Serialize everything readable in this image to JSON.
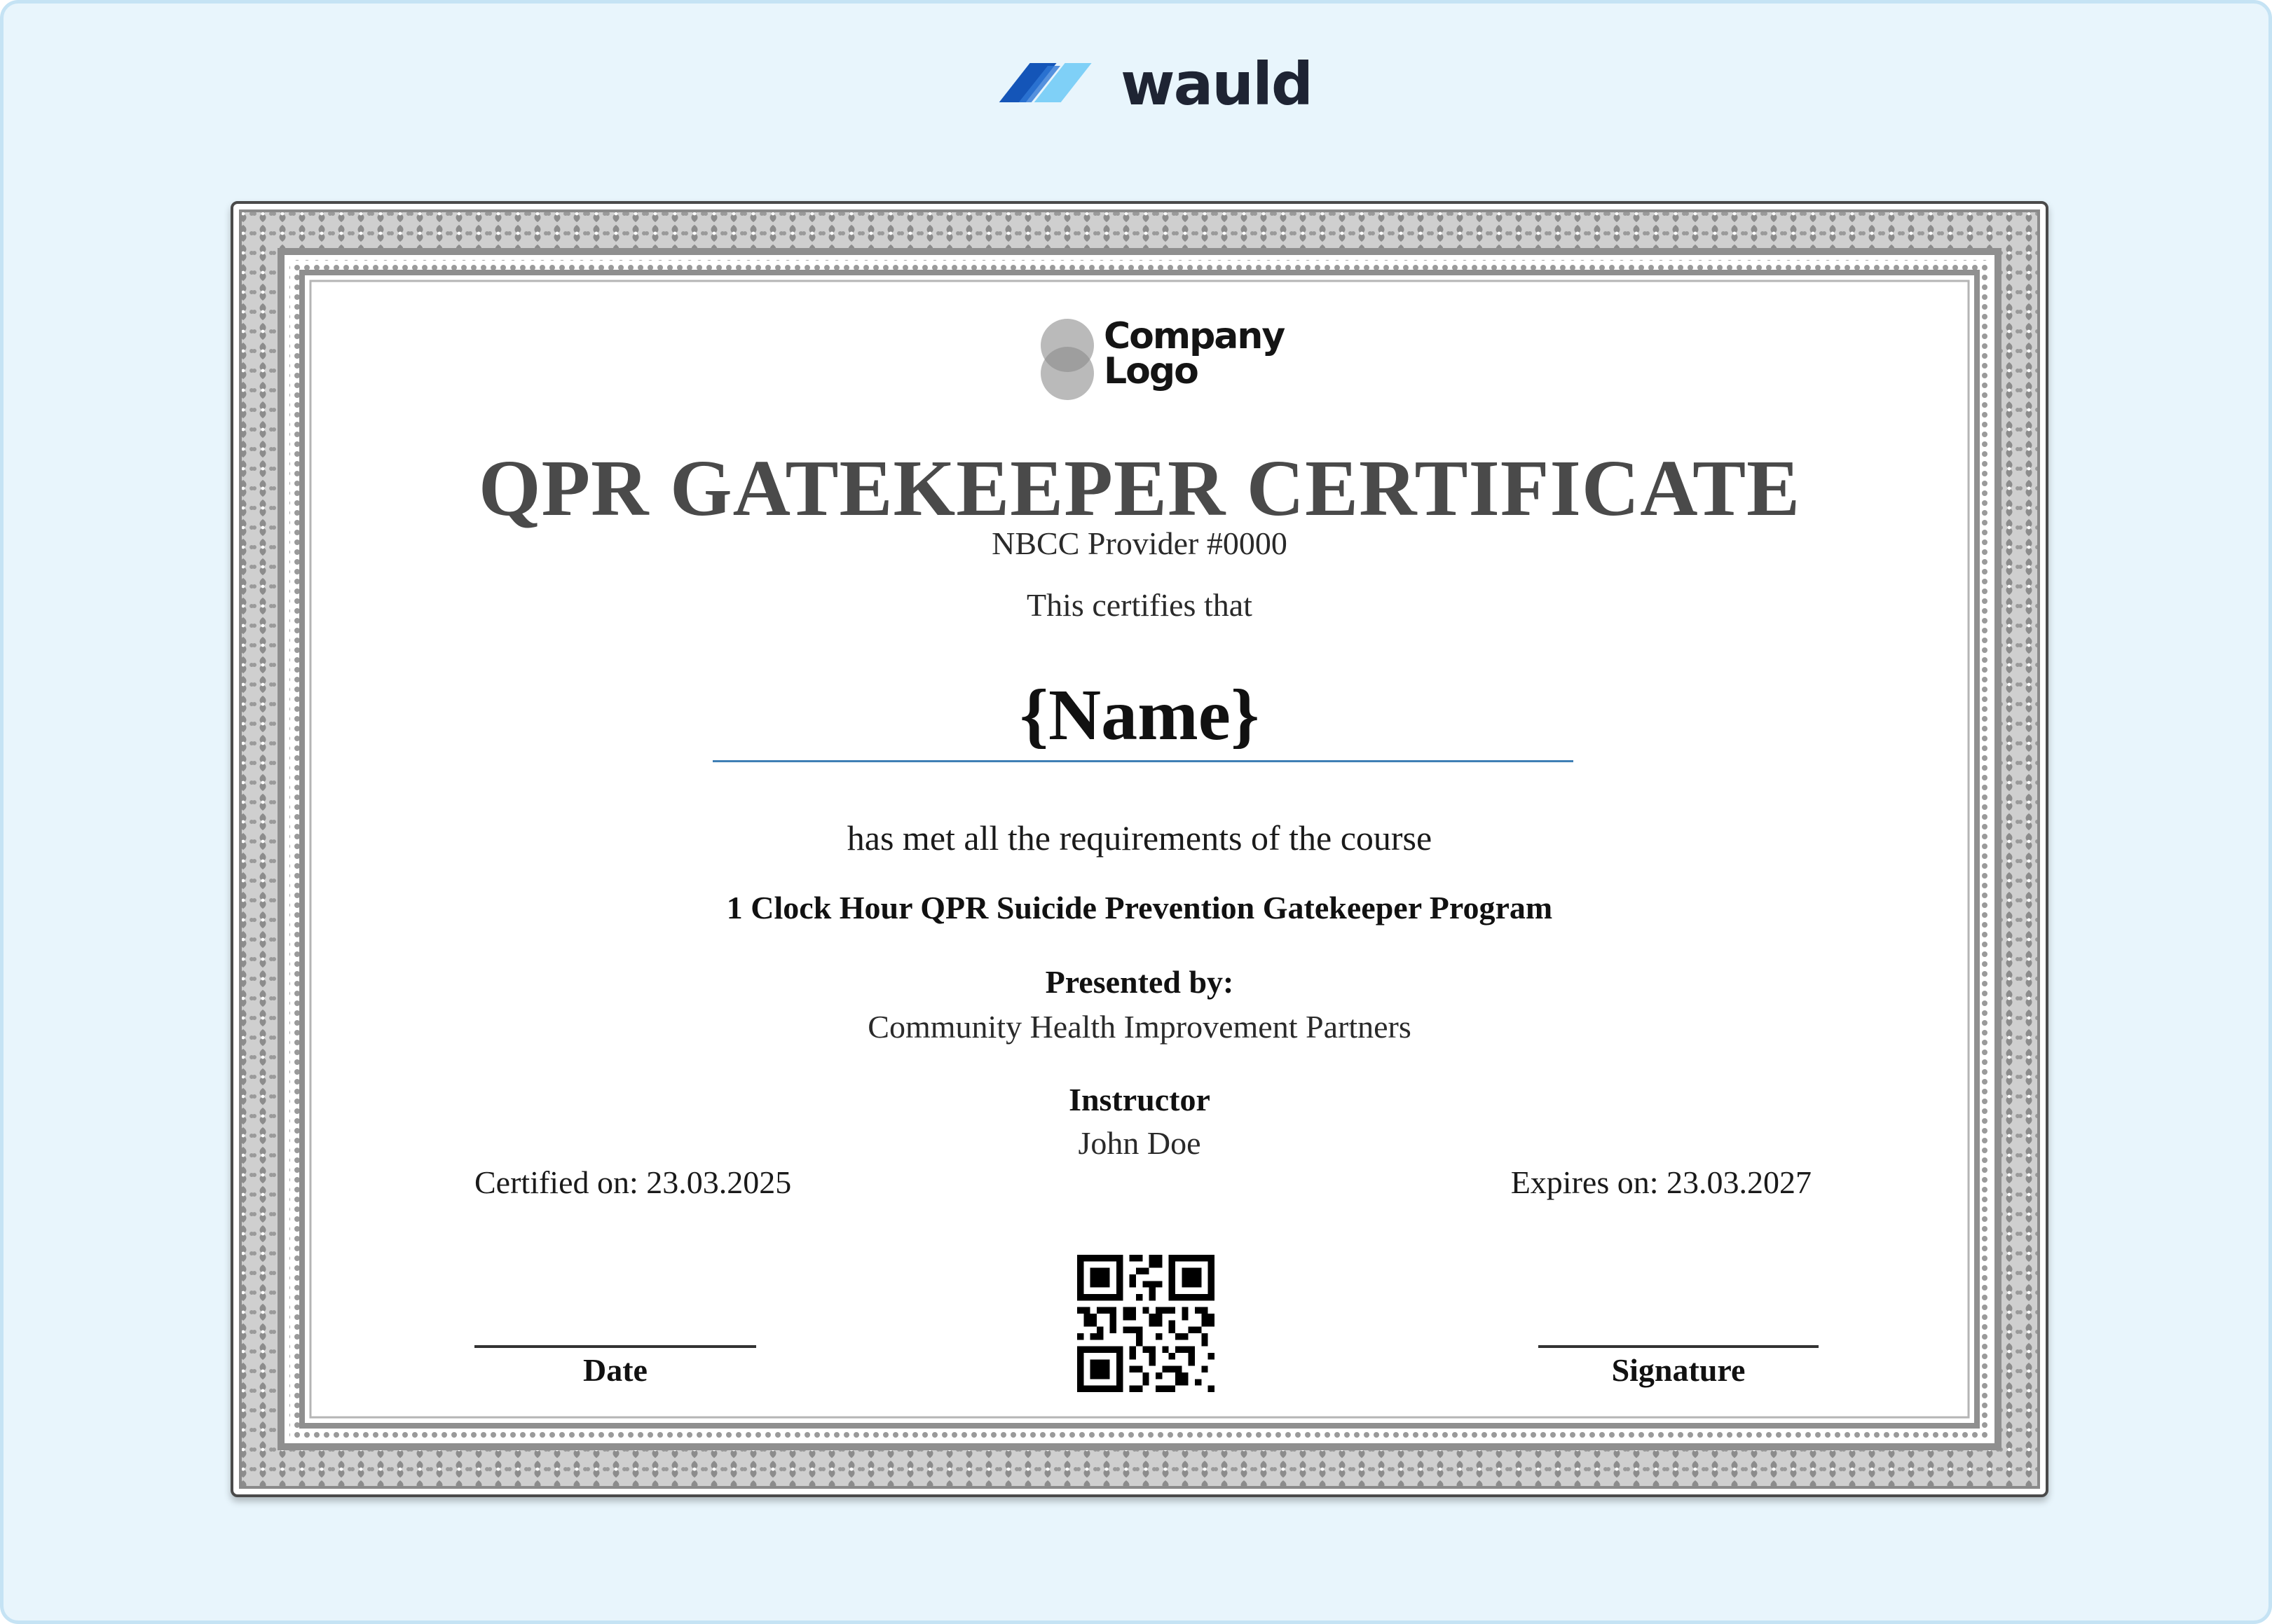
{
  "brand": {
    "name": "wauld",
    "colors": {
      "dark": "#1455b8",
      "light": "#7fd0f7",
      "text": "#1e2433"
    }
  },
  "certificate": {
    "logo_text_line1": "Company",
    "logo_text_line2": "Logo",
    "title": "QPR GATEKEEPER CERTIFICATE",
    "provider": "NBCC Provider #0000",
    "certifies_text": "This certifies that",
    "recipient_name": "{Name}",
    "requirement_text": "has met all the requirements of the course",
    "course_name": "1 Clock Hour QPR Suicide Prevention Gatekeeper Program",
    "presented_by_label": "Presented by:",
    "presenter": "Community Health Improvement Partners",
    "instructor_label": "Instructor",
    "instructor_name": "John Doe",
    "certified_on": "Certified on: 23.03.2025",
    "expires_on": "Expires on: 23.03.2027",
    "date_label": "Date",
    "signature_label": "Signature",
    "name_underline_color": "#3f7fb5",
    "title_color": "#4a4a4a",
    "border_color": "#9a9a9a"
  }
}
